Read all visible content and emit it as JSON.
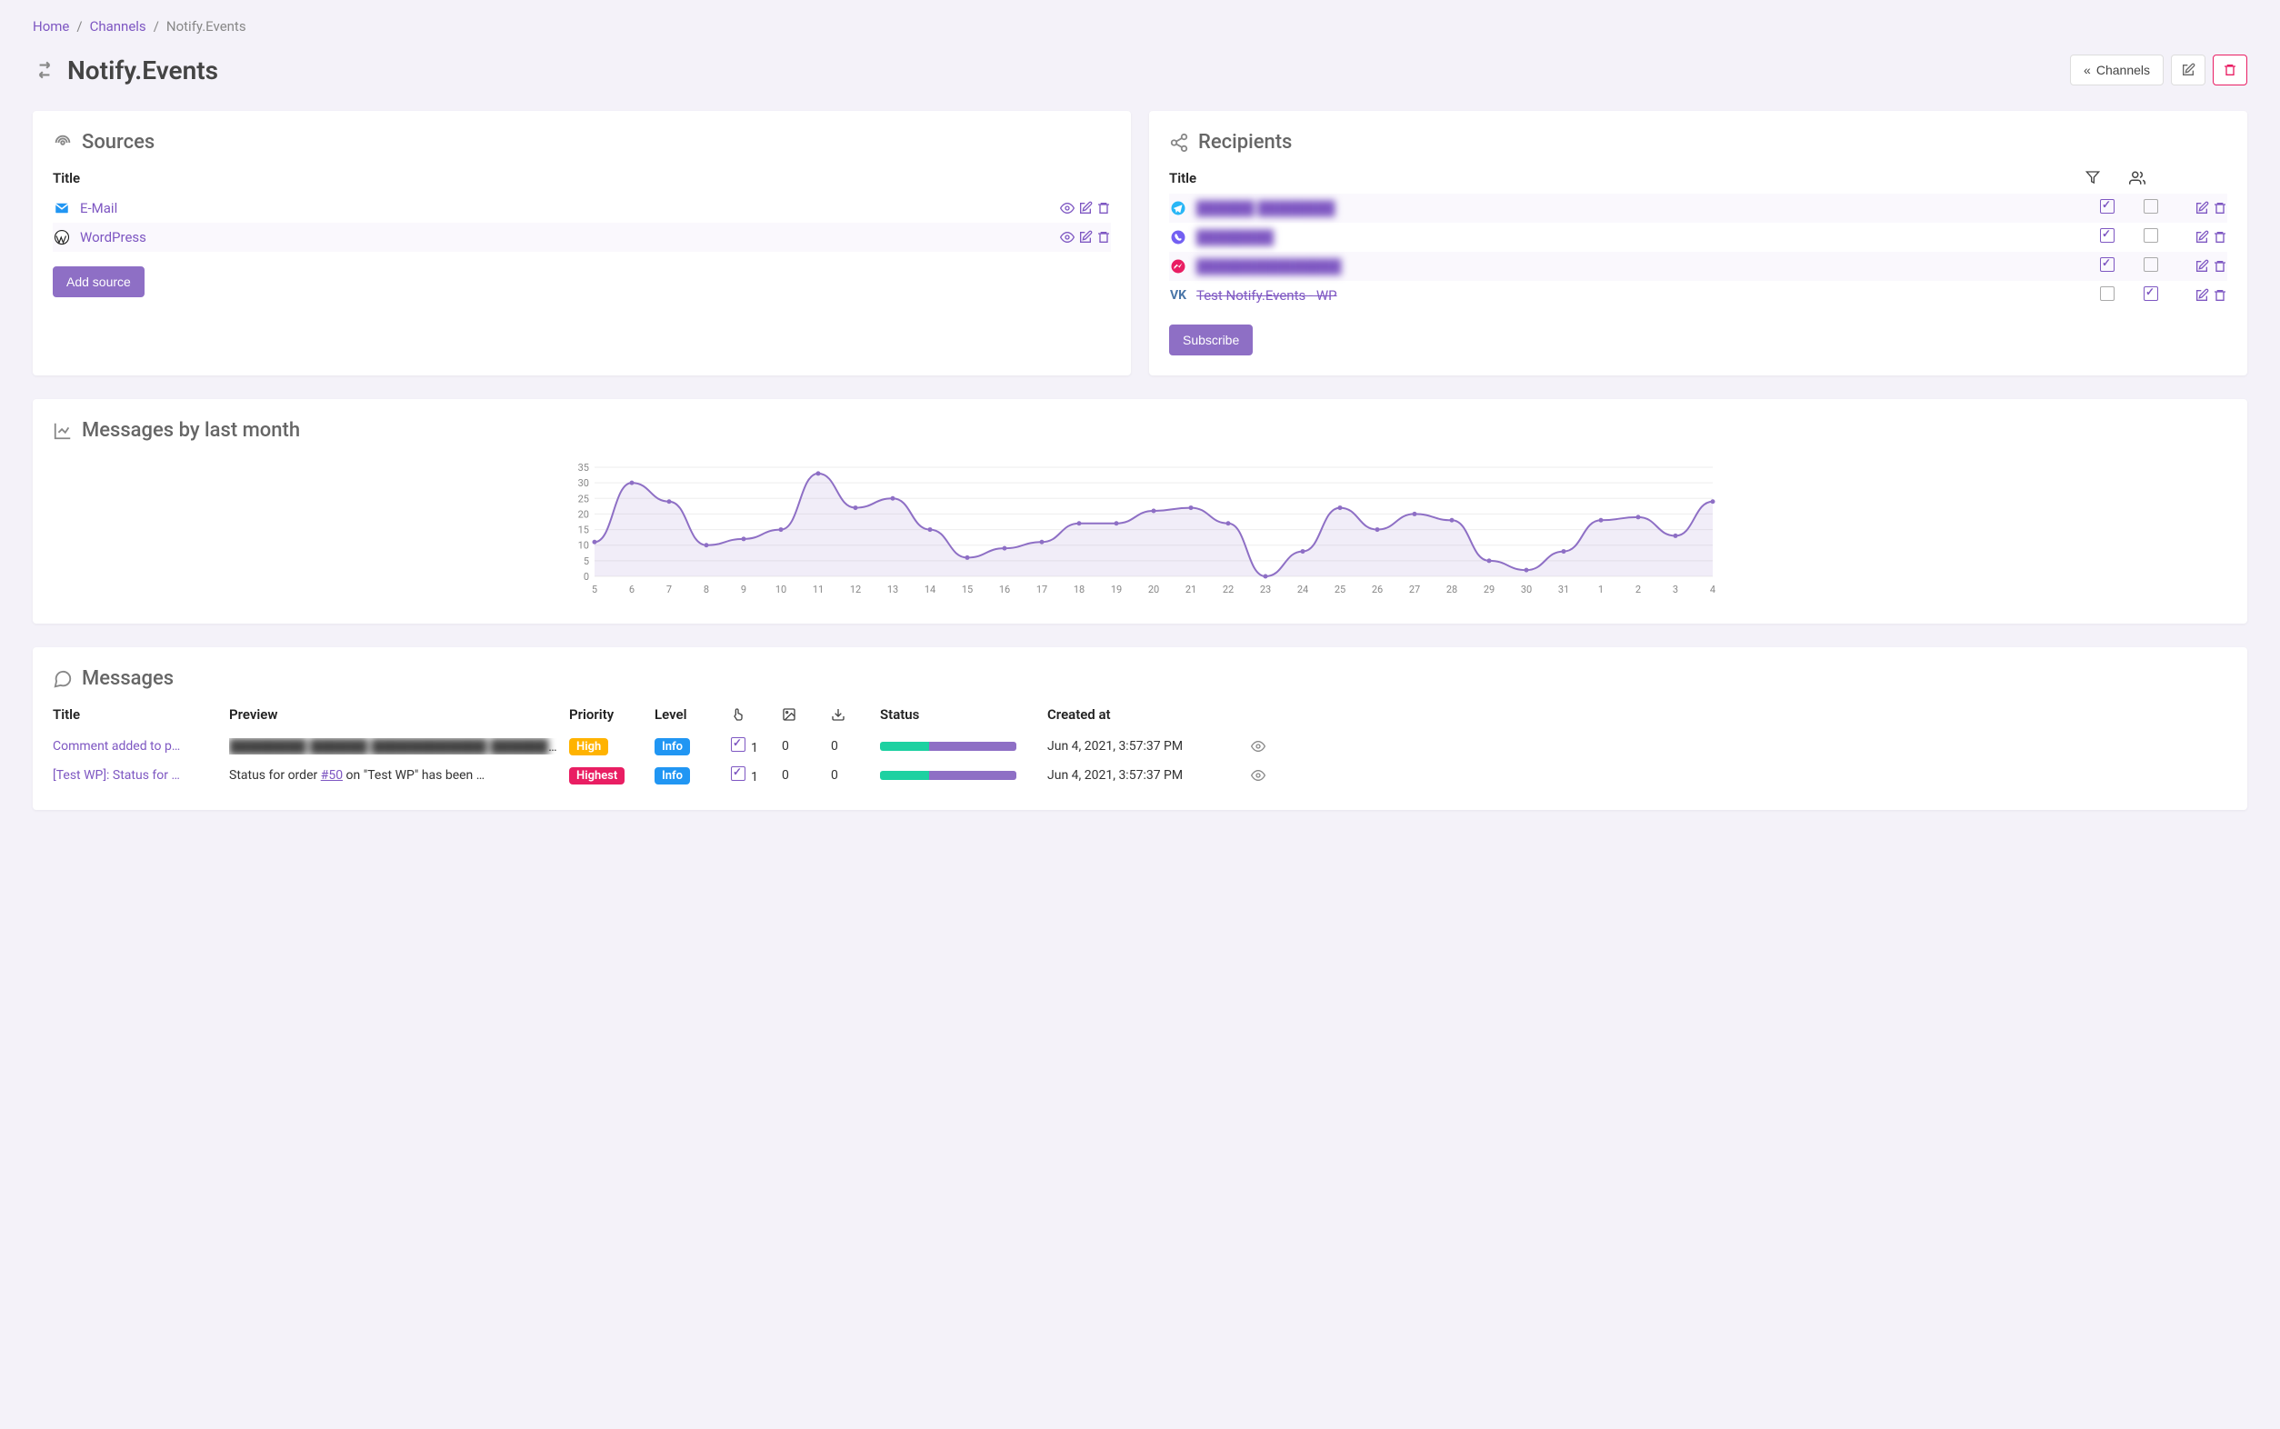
{
  "breadcrumb": {
    "home": "Home",
    "channels": "Channels",
    "current": "Notify.Events"
  },
  "page_title": "Notify.Events",
  "title_actions": {
    "channels_btn": "Channels"
  },
  "sources": {
    "heading": "Sources",
    "col_title": "Title",
    "items": [
      {
        "icon": "email-icon",
        "label": "E-Mail"
      },
      {
        "icon": "wordpress-icon",
        "label": "WordPress"
      }
    ],
    "add_btn": "Add source"
  },
  "recipients": {
    "heading": "Recipients",
    "col_title": "Title",
    "items": [
      {
        "icon": "telegram-icon",
        "label": "██████ ████████",
        "blurred": true,
        "filter_checked": true,
        "group_checked": false
      },
      {
        "icon": "viber-icon",
        "label": "████████",
        "blurred": true,
        "filter_checked": true,
        "group_checked": false
      },
      {
        "icon": "messenger-icon",
        "label": "███████████████",
        "blurred": true,
        "filter_checked": true,
        "group_checked": false
      },
      {
        "icon": "vk-icon",
        "label": "Test Notify.Events - WP",
        "blurred": false,
        "struck": true,
        "filter_checked": false,
        "group_checked": true
      }
    ],
    "subscribe_btn": "Subscribe"
  },
  "chart": {
    "heading": "Messages by last month"
  },
  "chart_data": {
    "type": "line",
    "title": "Messages by last month",
    "xlabel": "",
    "ylabel": "",
    "ylim": [
      0,
      35
    ],
    "x": [
      5,
      6,
      7,
      8,
      9,
      10,
      11,
      12,
      13,
      14,
      15,
      16,
      17,
      18,
      19,
      20,
      21,
      22,
      23,
      24,
      25,
      26,
      27,
      28,
      29,
      30,
      31,
      1,
      2,
      3,
      4
    ],
    "values": [
      11,
      30,
      24,
      10,
      12,
      15,
      33,
      22,
      25,
      15,
      6,
      9,
      11,
      17,
      17,
      21,
      22,
      17,
      0,
      8,
      22,
      15,
      20,
      18,
      5,
      2,
      8,
      18,
      19,
      13,
      24
    ],
    "yticks": [
      0,
      5,
      10,
      15,
      20,
      25,
      30,
      35
    ]
  },
  "messages": {
    "heading": "Messages",
    "cols": {
      "title": "Title",
      "preview": "Preview",
      "priority": "Priority",
      "level": "Level",
      "status": "Status",
      "created": "Created at"
    },
    "rows": [
      {
        "title": "Comment added to p…",
        "preview_blurred": true,
        "preview": "",
        "priority": "High",
        "priority_class": "badge-high",
        "level": "Info",
        "clicks": "1",
        "images": "0",
        "downloads": "0",
        "status_segments": [
          {
            "color": "#1dd1a1",
            "pct": 36
          },
          {
            "color": "#8e6fc5",
            "pct": 64
          }
        ],
        "created": "Jun 4, 2021, 3:57:37 PM"
      },
      {
        "title": "[Test WP]: Status for …",
        "preview_blurred": false,
        "preview_prefix": "Status for order ",
        "preview_link": "#50",
        "preview_suffix": " on \"Test WP\" has been …",
        "priority": "Highest",
        "priority_class": "badge-highest",
        "level": "Info",
        "clicks": "1",
        "images": "0",
        "downloads": "0",
        "status_segments": [
          {
            "color": "#1dd1a1",
            "pct": 36
          },
          {
            "color": "#8e6fc5",
            "pct": 64
          }
        ],
        "created": "Jun 4, 2021, 3:57:37 PM"
      }
    ]
  },
  "colors": {
    "accent": "#8e6fc5",
    "link": "#7e57c2",
    "danger": "#e91e63"
  }
}
